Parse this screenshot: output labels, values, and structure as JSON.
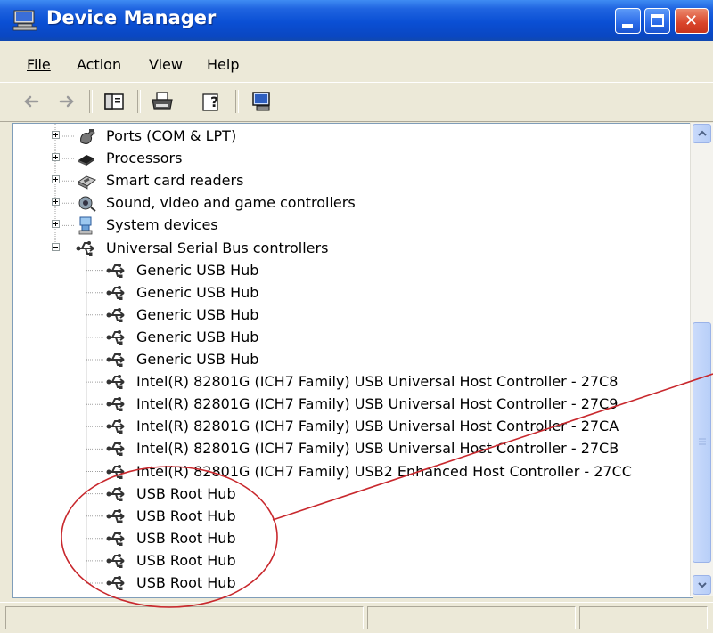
{
  "window": {
    "title": "Device Manager",
    "controls": {
      "minimize": "minimize",
      "maximize": "maximize",
      "close": "✕"
    }
  },
  "menu": {
    "file": "File",
    "action": "Action",
    "view": "View",
    "help": "Help"
  },
  "tree": {
    "categories": [
      {
        "label": "Ports (COM & LPT)",
        "icon": "port-icon",
        "expanded": false
      },
      {
        "label": "Processors",
        "icon": "processor-icon",
        "expanded": false
      },
      {
        "label": "Smart card readers",
        "icon": "smartcard-icon",
        "expanded": false
      },
      {
        "label": "Sound, video and game controllers",
        "icon": "sound-icon",
        "expanded": false
      },
      {
        "label": "System devices",
        "icon": "system-device-icon",
        "expanded": false
      },
      {
        "label": "Universal Serial Bus controllers",
        "icon": "usb-icon",
        "expanded": true
      }
    ],
    "usb_children": [
      "Generic USB Hub",
      "Generic USB Hub",
      "Generic USB Hub",
      "Generic USB Hub",
      "Generic USB Hub",
      "Intel(R) 82801G (ICH7 Family) USB Universal Host Controller - 27C8",
      "Intel(R) 82801G (ICH7 Family) USB Universal Host Controller - 27C9",
      "Intel(R) 82801G (ICH7 Family) USB Universal Host Controller - 27CA",
      "Intel(R) 82801G (ICH7 Family) USB Universal Host Controller - 27CB",
      "Intel(R) 82801G (ICH7 Family) USB2 Enhanced Host Controller - 27CC",
      "USB Root Hub",
      "USB Root Hub",
      "USB Root Hub",
      "USB Root Hub",
      "USB Root Hub"
    ]
  },
  "colors": {
    "titlebar": "#0a4fd4",
    "annotation": "#c8282d",
    "usb_icon": "#3a3a3a"
  }
}
